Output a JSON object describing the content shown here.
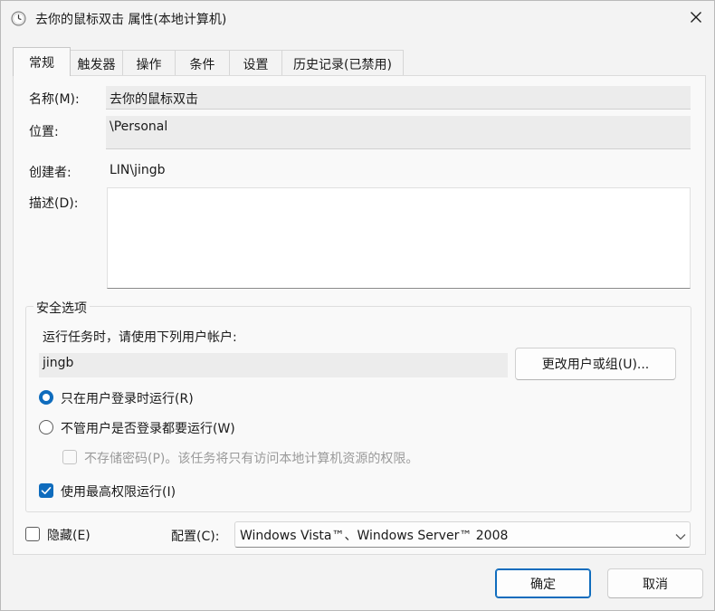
{
  "window": {
    "title": "去你的鼠标双击 属性(本地计算机)",
    "icon": "clock-icon",
    "close_icon": "close-icon"
  },
  "tabs": [
    {
      "label": "常规",
      "active": true
    },
    {
      "label": "触发器",
      "active": false
    },
    {
      "label": "操作",
      "active": false
    },
    {
      "label": "条件",
      "active": false
    },
    {
      "label": "设置",
      "active": false
    },
    {
      "label": "历史记录(已禁用)",
      "active": false
    }
  ],
  "general": {
    "name_label": "名称(M):",
    "name_value": "去你的鼠标双击",
    "location_label": "位置:",
    "location_value": "\\Personal",
    "author_label": "创建者:",
    "author_value": "LIN\\jingb",
    "description_label": "描述(D):",
    "description_value": ""
  },
  "security": {
    "legend": "安全选项",
    "run_as_prompt": "运行任务时，请使用下列用户帐户:",
    "account": "jingb",
    "change_user_button": "更改用户或组(U)...",
    "option_logged_on": {
      "label": "只在用户登录时运行(R)",
      "checked": true
    },
    "option_whether_logged_on": {
      "label": "不管用户是否登录都要运行(W)",
      "checked": false
    },
    "do_not_store_password": {
      "label": "不存储密码(P)。该任务将只有访问本地计算机资源的权限。",
      "checked": false,
      "disabled": true
    },
    "run_highest_privileges": {
      "label": "使用最高权限运行(I)",
      "checked": true
    }
  },
  "bottom": {
    "hidden": {
      "label": "隐藏(E)",
      "checked": false
    },
    "config_label": "配置(C):",
    "config_value": "Windows Vista™、Windows Server™ 2008"
  },
  "buttons": {
    "ok": "确定",
    "cancel": "取消"
  },
  "colors": {
    "accent": "#0f6cbd",
    "window_bg": "#f3f3f3",
    "panel_bg": "#f9f9f9"
  }
}
